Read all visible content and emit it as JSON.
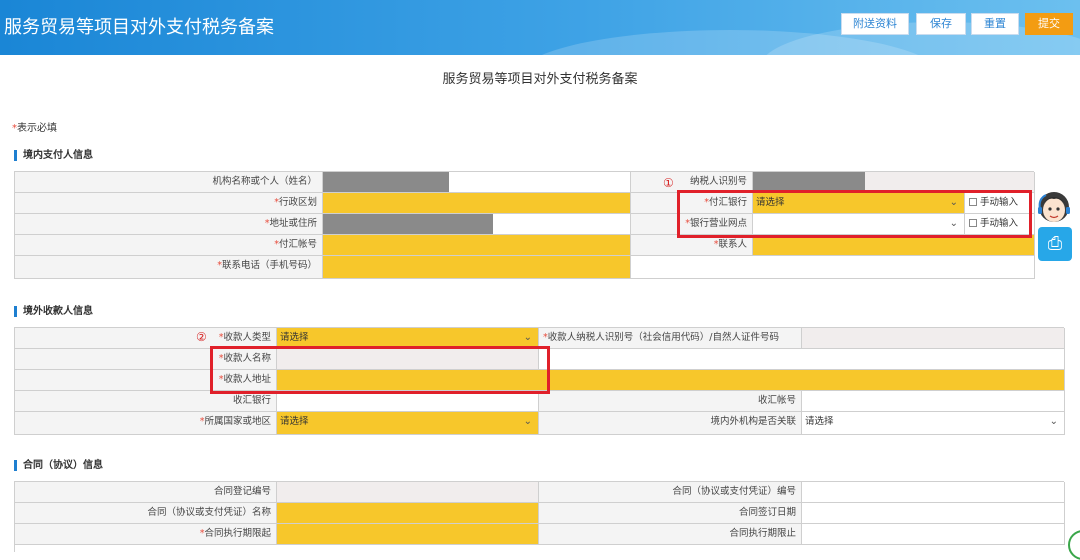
{
  "app_title": "服务贸易等项目对外支付税务备案",
  "toolbar": {
    "attach": "附送资料",
    "save": "保存",
    "reset": "重置",
    "submit": "提交"
  },
  "doc_title": "服务贸易等项目对外支付税务备案",
  "required_note": {
    "star": "*",
    "text": "表示必填"
  },
  "markers": {
    "one": "①",
    "two": "②"
  },
  "domestic_payer": {
    "title": "境内支付人信息",
    "org_name_label": "机构名称或个人（姓名）",
    "tax_id_label": "纳税人识别号",
    "admin_region_label": "行政区划",
    "pay_bank_label": "付汇银行",
    "pay_bank_value": "请选择",
    "manual_input_1": "手动输入",
    "address_label": "地址或住所",
    "bank_branch_label": "银行营业网点",
    "manual_input_2": "手动输入",
    "pay_account_label": "付汇帐号",
    "contact_label": "联系人",
    "phone_label": "联系电话（手机号码）"
  },
  "overseas_payee": {
    "title": "境外收款人信息",
    "payee_type_label": "收款人类型",
    "payee_type_value": "请选择",
    "payee_tax_id_label": "收款人纳税人识别号（社会信用代码）/自然人证件号码",
    "payee_name_label": "收款人名称",
    "payee_address_label": "收款人地址",
    "receive_bank_label": "收汇银行",
    "receive_account_label": "收汇帐号",
    "country_label": "所属国家或地区",
    "country_value": "请选择",
    "related_label": "境内外机构是否关联",
    "related_value": "请选择"
  },
  "contract": {
    "title": "合同（协议）信息",
    "reg_no_label": "合同登记编号",
    "contract_no_label": "合同（协议或支付凭证）编号",
    "contract_name_label": "合同（协议或支付凭证）名称",
    "sign_date_label": "合同签订日期",
    "start_label": "合同执行期限起",
    "end_label": "合同执行期限止"
  },
  "colors": {
    "header_blue": "#1a86d6",
    "required_yellow": "#f7c72b",
    "submit_orange": "#f39c12",
    "highlight_red": "#e0202a"
  }
}
